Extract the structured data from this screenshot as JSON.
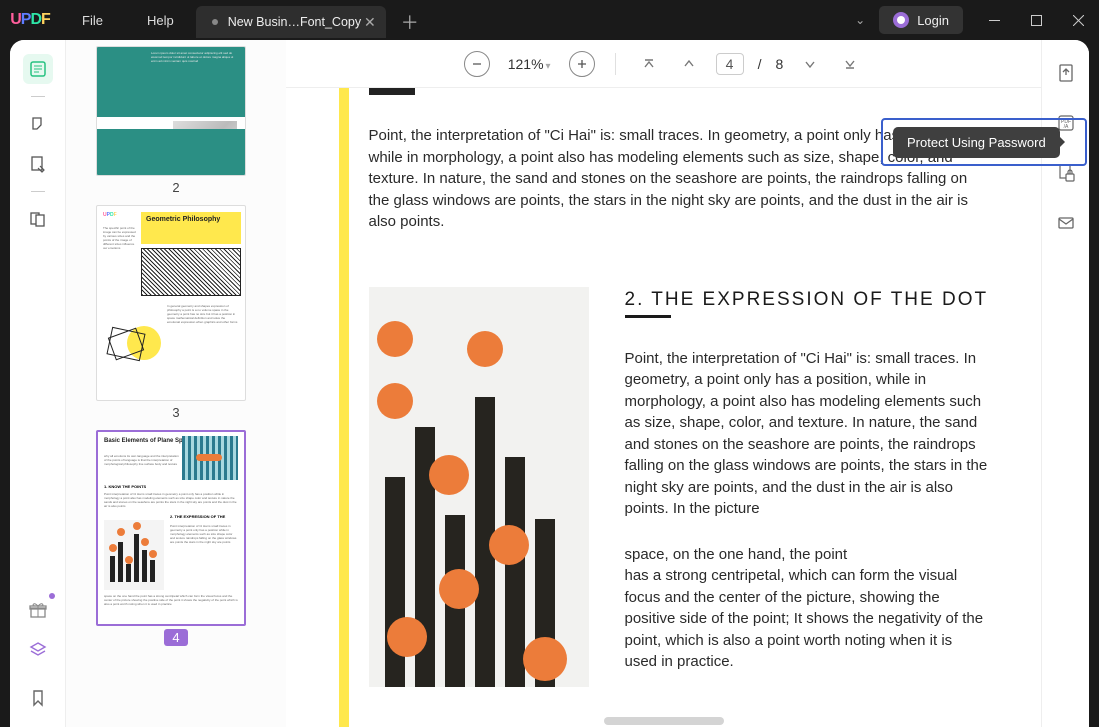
{
  "menu": {
    "file": "File",
    "help": "Help"
  },
  "tab": {
    "title": "New Busin…Font_Copy"
  },
  "login": "Login",
  "toolbar": {
    "zoom": "121%",
    "page_current": "4",
    "page_sep": "/",
    "page_total": "8"
  },
  "thumbs": {
    "p2_label": "2",
    "p3_label": "3",
    "p4_label": "4",
    "p3_title": "Geometric Philosophy",
    "p4_title": "Basic Elements of Plane Space",
    "p4_sub1": "1. KNOW THE POINTS",
    "p4_sub2": "2. THE EXPRESSION OF THE"
  },
  "tooltip": {
    "protect": "Protect Using Password"
  },
  "doc": {
    "para1": "Point, the interpretation of \"Ci Hai\" is: small traces. In geometry, a point only has a position, while in morphology, a point also has modeling elements such as size, shape, color, and texture. In nature, the sand and stones on the seashore are points, the raindrops falling on the glass windows are points, the stars in the night sky are points, and the dust in the air is also points.",
    "heading2": "2. THE EXPRESSION OF THE DOT",
    "para2": "Point, the interpretation of \"Ci Hai\" is: small traces. In geometry, a point only has a position, while in morphology, a point also has modeling elements such as size, shape, color, and texture. In nature, the sand and stones on the seashore are points, the raindrops falling on the glass windows are points, the stars in the night sky are points, and the dust in the air is also points. In the picture",
    "para3": "space, on the one hand, the point",
    "para4": "has a strong centripetal, which can form the visual focus and the center of the picture, showing the positive side of the point; It shows the negativity of the point, which is also a point worth noting when it is used in practice."
  }
}
